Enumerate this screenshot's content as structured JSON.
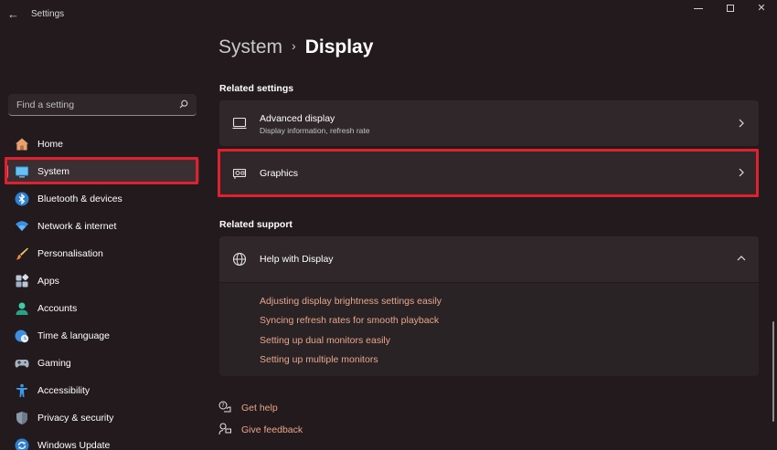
{
  "window": {
    "title": "Settings",
    "back_glyph": "←",
    "close_glyph": "✕"
  },
  "search": {
    "placeholder": "Find a setting",
    "icon": "search-icon"
  },
  "sidebar": {
    "items": [
      {
        "label": "Home",
        "icon": "home-icon"
      },
      {
        "label": "System",
        "icon": "system-icon",
        "selected": true
      },
      {
        "label": "Bluetooth & devices",
        "icon": "bluetooth-icon"
      },
      {
        "label": "Network & internet",
        "icon": "wifi-icon"
      },
      {
        "label": "Personalisation",
        "icon": "brush-icon"
      },
      {
        "label": "Apps",
        "icon": "apps-icon"
      },
      {
        "label": "Accounts",
        "icon": "accounts-icon"
      },
      {
        "label": "Time & language",
        "icon": "globe-clock-icon"
      },
      {
        "label": "Gaming",
        "icon": "gamepad-icon"
      },
      {
        "label": "Accessibility",
        "icon": "accessibility-icon"
      },
      {
        "label": "Privacy & security",
        "icon": "shield-icon"
      },
      {
        "label": "Windows Update",
        "icon": "update-icon"
      }
    ]
  },
  "breadcrumb": {
    "parent": "System",
    "separator": "›",
    "current": "Display"
  },
  "related_settings": {
    "heading": "Related settings",
    "items": [
      {
        "title": "Advanced display",
        "subtitle": "Display information, refresh rate",
        "icon": "monitor-icon"
      },
      {
        "title": "Graphics",
        "icon": "graphics-card-icon"
      }
    ]
  },
  "related_support": {
    "heading": "Related support",
    "help": {
      "title": "Help with Display",
      "icon": "globe-icon",
      "links": [
        "Adjusting display brightness settings easily",
        "Syncing refresh rates for smooth playback",
        "Setting up dual monitors easily",
        "Setting up multiple monitors"
      ]
    }
  },
  "footer": {
    "get_help": "Get help",
    "give_feedback": "Give feedback"
  },
  "colors": {
    "background": "#221a1c",
    "card": "#2f2729",
    "accent": "#ff4b5a",
    "link": "#e8a68c",
    "highlight": "#e0202e"
  }
}
